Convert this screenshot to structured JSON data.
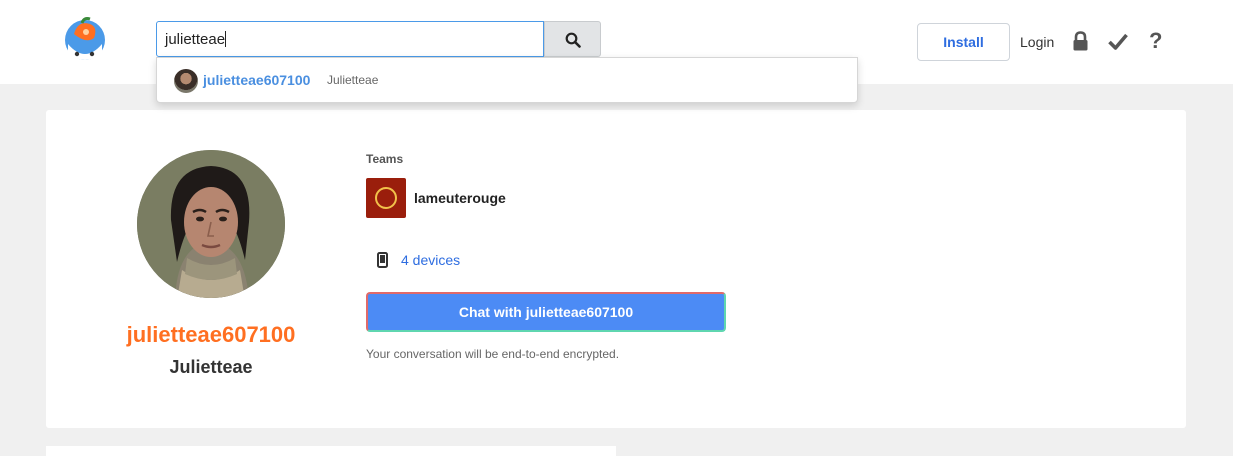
{
  "header": {
    "logo_icon": "keybase-logo-icon",
    "search": {
      "value": "julietteae"
    },
    "search_icon": "search-icon",
    "install_label": "Install",
    "login_label": "Login",
    "lock_icon": "lock-icon",
    "check_icon": "check-icon",
    "help_label": "?"
  },
  "dropdown": {
    "results": [
      {
        "username": "julietteae607100",
        "full_name": "Julietteae"
      }
    ]
  },
  "profile": {
    "username": "julietteae607100",
    "full_name": "Julietteae",
    "teams_label": "Teams",
    "teams": [
      {
        "name": "lameuterouge"
      }
    ],
    "devices_label": "4 devices",
    "chat_button_label": "Chat with julietteae607100",
    "encryption_note": "Your conversation will be end-to-end encrypted."
  },
  "colors": {
    "accent_orange": "#ff6f21",
    "link_blue": "#2e6de0",
    "chat_blue": "#4c8bf5"
  }
}
